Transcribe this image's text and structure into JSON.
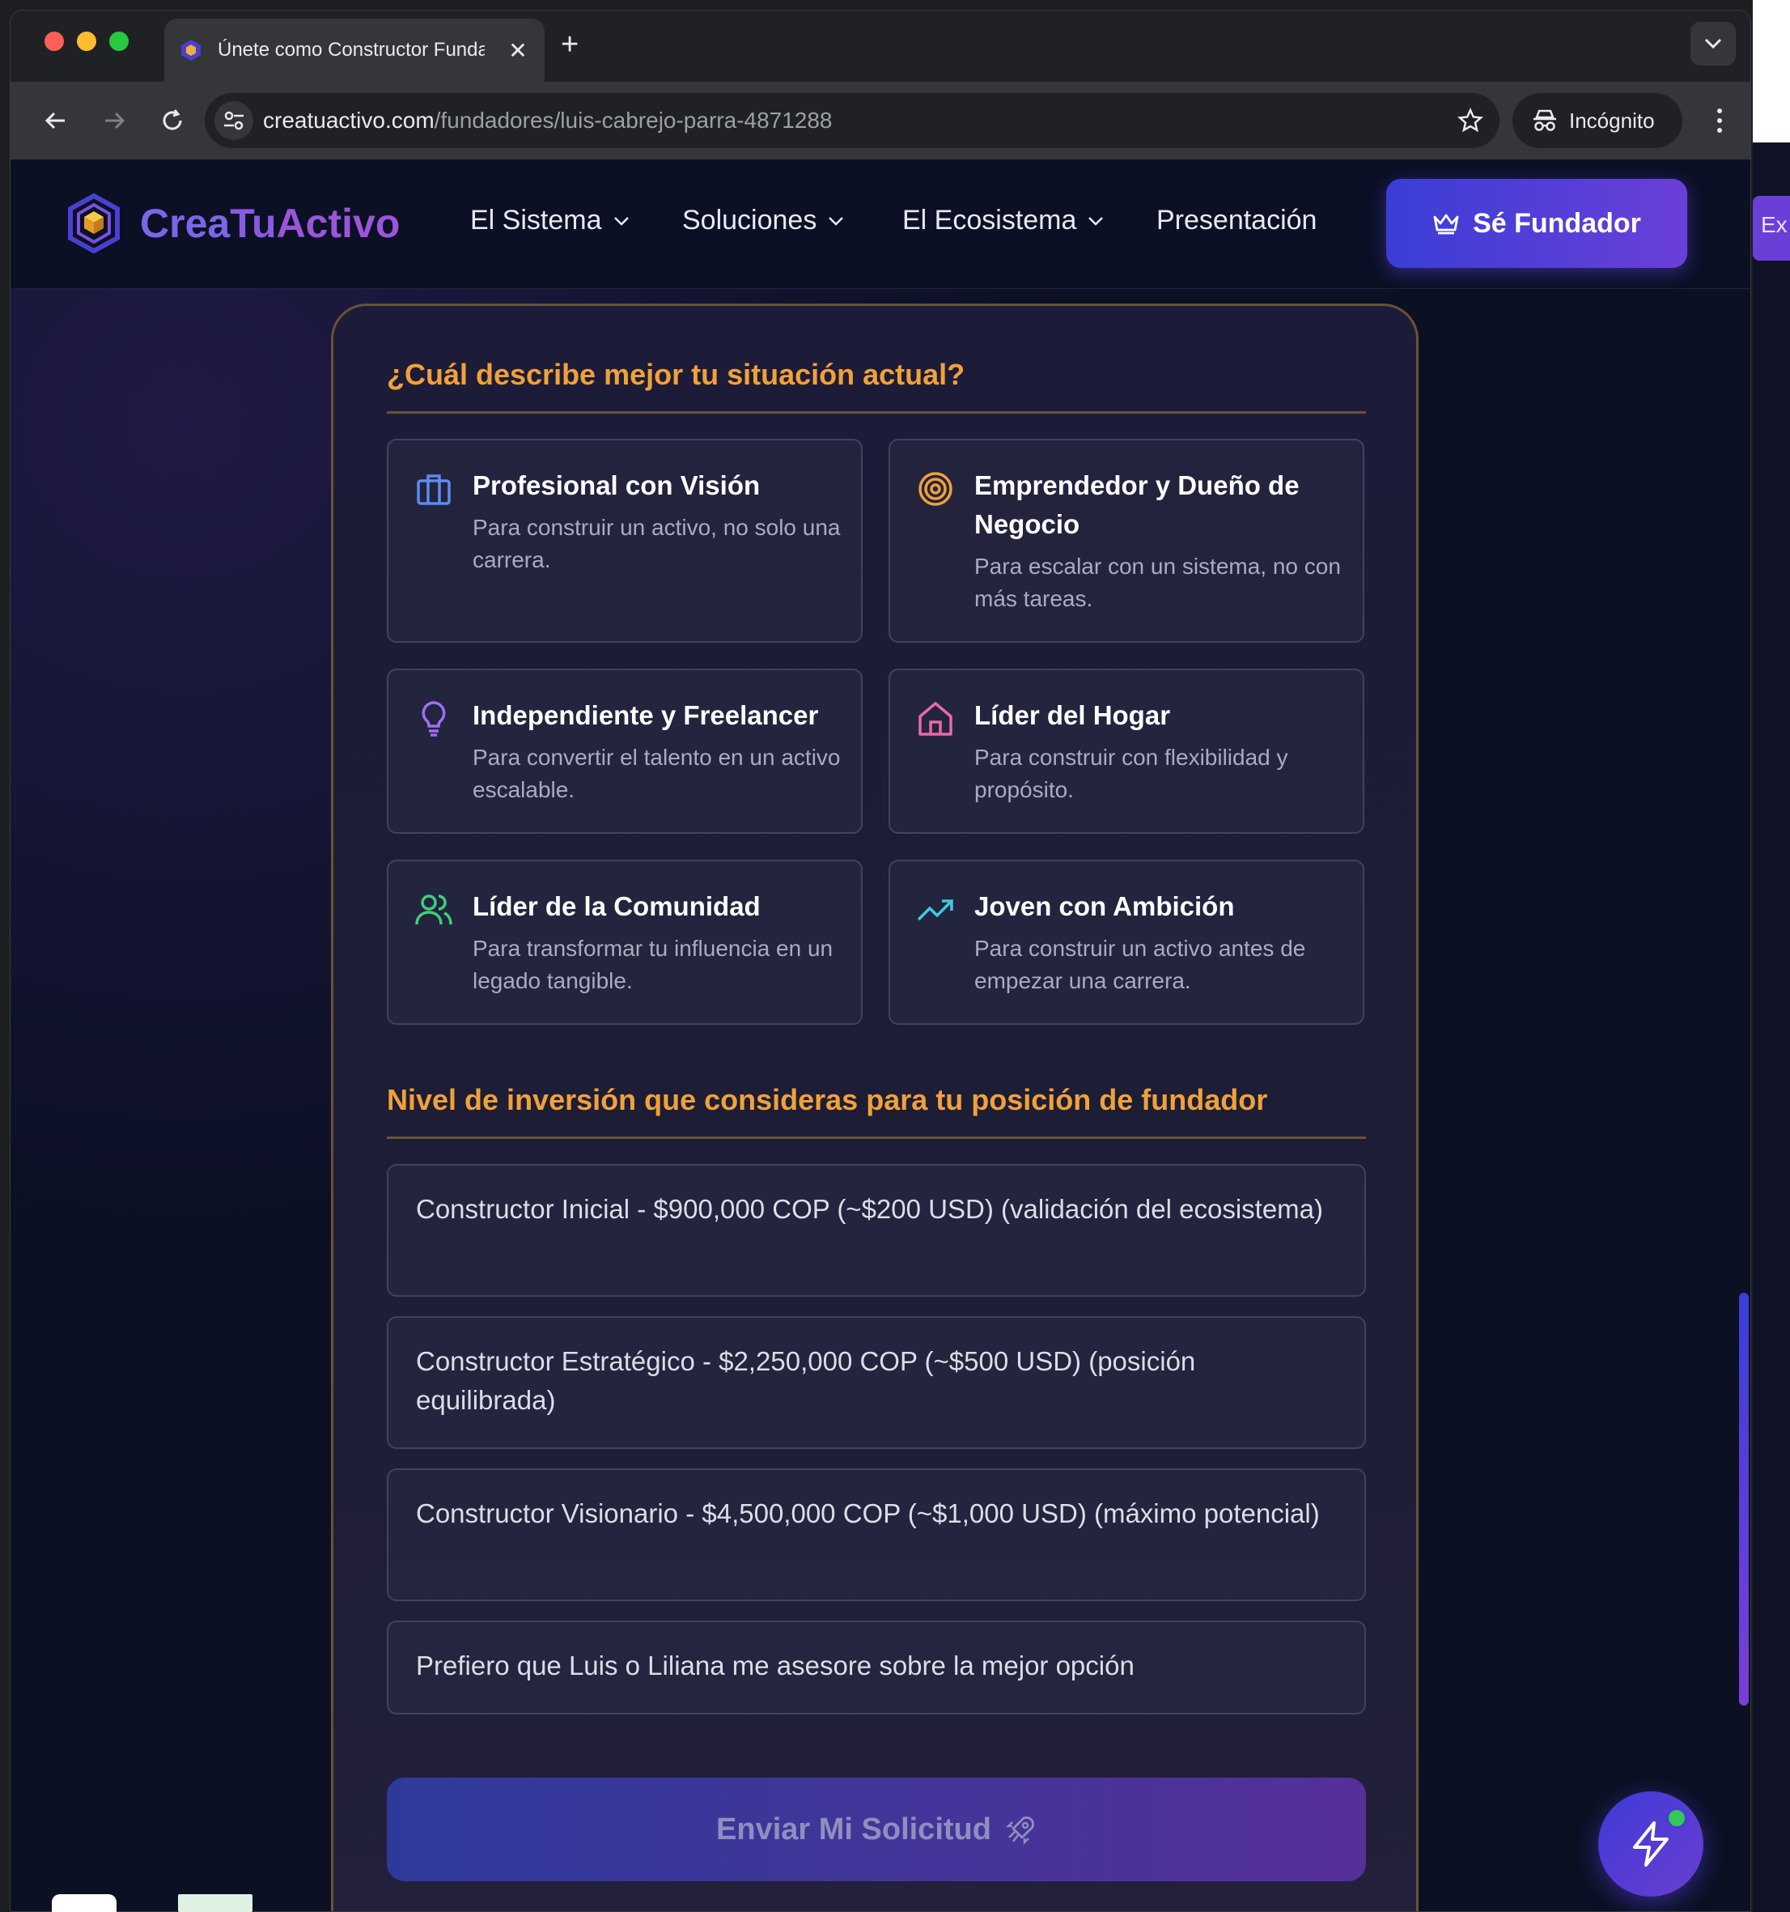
{
  "browser": {
    "tab_title": "Únete como Constructor Fundador",
    "new_tab_label": "+",
    "url_domain": "creatuactivo.com",
    "url_path": "/fundadores/luis-cabrejo-parra-4871288",
    "incognito_label": "Incógnito"
  },
  "header": {
    "logo_text_1": "Crea",
    "logo_text_2": "Tu",
    "logo_text_3": "Activo",
    "nav": [
      "El Sistema",
      "Soluciones",
      "El Ecosistema",
      "Presentación"
    ],
    "cta_label": "Sé Fundador"
  },
  "form": {
    "situation_title": "¿Cuál describe mejor tu situación actual?",
    "options": [
      {
        "title": "Profesional con Visión",
        "desc": "Para construir un activo, no solo una carrera.",
        "icon": "briefcase-icon",
        "color": "#5b8def"
      },
      {
        "title": "Emprendedor y Dueño de Negocio",
        "desc": "Para escalar con un sistema, no con más tareas.",
        "icon": "target-icon",
        "color": "#f0a13a"
      },
      {
        "title": "Independiente y Freelancer",
        "desc": "Para convertir el talento en un activo escalable.",
        "icon": "lightbulb-icon",
        "color": "#a06ef0"
      },
      {
        "title": "Líder del Hogar",
        "desc": "Para construir con flexibilidad y propósito.",
        "icon": "home-icon",
        "color": "#e86aa8"
      },
      {
        "title": "Líder de la Comunidad",
        "desc": "Para transformar tu influencia en un legado tangible.",
        "icon": "users-icon",
        "color": "#3ecf7a"
      },
      {
        "title": "Joven con Ambición",
        "desc": "Para construir un activo antes de empezar una carrera.",
        "icon": "trending-up-icon",
        "color": "#3ec8e0"
      }
    ],
    "investment_title": "Nivel de inversión que consideras para tu posición de fundador",
    "investment_options": [
      "Constructor Inicial - $900,000 COP (~$200 USD) (validación del ecosistema)",
      "Constructor Estratégico - $2,250,000 COP (~$500 USD) (posición equilibrada)",
      "Constructor Visionario - $4,500,000 COP (~$1,000 USD) (máximo potencial)",
      "Prefiero que Luis o Liliana me asesore sobre la mejor opción"
    ],
    "submit_label": "Enviar Mi Solicitud"
  },
  "peek": {
    "button_text": "Ex"
  },
  "colors": {
    "accent_orange": "#f0a13a",
    "brand_blue": "#3a3ed6",
    "brand_purple": "#6a3fd8"
  }
}
